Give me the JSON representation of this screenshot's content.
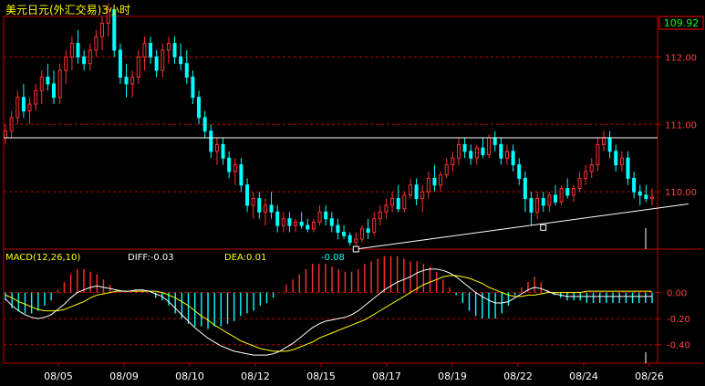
{
  "chart_data": [
    {
      "type": "candlestick",
      "title": "美元日元(外汇交易)3小时",
      "ylim": [
        109.15,
        112.6
      ],
      "y_ticks": [
        "112.00",
        "111.00",
        "110.00"
      ],
      "last_price": "109.92",
      "grid": "dashed horizontal",
      "x_ticks": [
        "08/05",
        "08/09",
        "08/10",
        "08/12",
        "08/15",
        "08/17",
        "08/19",
        "08/22",
        "08/24",
        "08/26"
      ],
      "candles": [
        [
          110.8,
          111.0,
          110.7,
          110.9
        ],
        [
          110.9,
          111.2,
          110.8,
          111.1
        ],
        [
          111.1,
          111.5,
          111.0,
          111.4
        ],
        [
          111.4,
          111.6,
          111.1,
          111.2
        ],
        [
          111.2,
          111.4,
          111.0,
          111.3
        ],
        [
          111.3,
          111.6,
          111.2,
          111.5
        ],
        [
          111.5,
          111.8,
          111.3,
          111.7
        ],
        [
          111.7,
          111.9,
          111.5,
          111.6
        ],
        [
          111.6,
          111.8,
          111.3,
          111.4
        ],
        [
          111.4,
          111.9,
          111.3,
          111.8
        ],
        [
          111.8,
          112.1,
          111.6,
          112.0
        ],
        [
          112.0,
          112.3,
          111.8,
          112.2
        ],
        [
          112.2,
          112.4,
          111.9,
          112.0
        ],
        [
          112.0,
          112.1,
          111.8,
          111.9
        ],
        [
          111.9,
          112.2,
          111.8,
          112.1
        ],
        [
          112.1,
          112.4,
          112.0,
          112.3
        ],
        [
          112.3,
          112.6,
          112.1,
          112.5
        ],
        [
          112.5,
          112.8,
          112.3,
          112.7
        ],
        [
          112.7,
          112.7,
          112.0,
          112.1
        ],
        [
          112.1,
          112.2,
          111.6,
          111.7
        ],
        [
          111.7,
          111.9,
          111.4,
          111.6
        ],
        [
          111.6,
          111.8,
          111.4,
          111.7
        ],
        [
          111.7,
          112.1,
          111.6,
          112.0
        ],
        [
          112.0,
          112.3,
          111.8,
          112.2
        ],
        [
          112.2,
          112.3,
          111.9,
          112.0
        ],
        [
          112.0,
          112.1,
          111.7,
          111.8
        ],
        [
          111.8,
          112.2,
          111.7,
          112.1
        ],
        [
          112.1,
          112.3,
          111.9,
          112.2
        ],
        [
          112.2,
          112.3,
          111.9,
          112.0
        ],
        [
          112.0,
          112.2,
          111.8,
          111.9
        ],
        [
          111.9,
          112.1,
          111.6,
          111.7
        ],
        [
          111.7,
          111.8,
          111.3,
          111.4
        ],
        [
          111.4,
          111.5,
          111.0,
          111.1
        ],
        [
          111.1,
          111.2,
          110.8,
          110.9
        ],
        [
          110.9,
          111.0,
          110.5,
          110.6
        ],
        [
          110.6,
          110.8,
          110.4,
          110.7
        ],
        [
          110.7,
          110.8,
          110.4,
          110.5
        ],
        [
          110.5,
          110.6,
          110.2,
          110.3
        ],
        [
          110.3,
          110.5,
          110.1,
          110.4
        ],
        [
          110.4,
          110.5,
          110.0,
          110.1
        ],
        [
          110.1,
          110.2,
          109.7,
          109.8
        ],
        [
          109.8,
          110.0,
          109.6,
          109.9
        ],
        [
          109.9,
          110.0,
          109.6,
          109.7
        ],
        [
          109.7,
          109.9,
          109.5,
          109.8
        ],
        [
          109.8,
          110.0,
          109.6,
          109.7
        ],
        [
          109.7,
          109.8,
          109.4,
          109.5
        ],
        [
          109.5,
          109.7,
          109.4,
          109.6
        ],
        [
          109.6,
          109.7,
          109.4,
          109.5
        ],
        [
          109.5,
          109.6,
          109.4,
          109.55
        ],
        [
          109.55,
          109.7,
          109.45,
          109.5
        ],
        [
          109.5,
          109.6,
          109.4,
          109.45
        ],
        [
          109.45,
          109.6,
          109.4,
          109.55
        ],
        [
          109.55,
          109.8,
          109.5,
          109.7
        ],
        [
          109.7,
          109.8,
          109.5,
          109.6
        ],
        [
          109.6,
          109.7,
          109.4,
          109.5
        ],
        [
          109.5,
          109.6,
          109.3,
          109.4
        ],
        [
          109.4,
          109.5,
          109.3,
          109.35
        ],
        [
          109.35,
          109.4,
          109.2,
          109.25
        ],
        [
          109.25,
          109.4,
          109.15,
          109.3
        ],
        [
          109.3,
          109.5,
          109.25,
          109.45
        ],
        [
          109.45,
          109.6,
          109.3,
          109.4
        ],
        [
          109.4,
          109.7,
          109.35,
          109.6
        ],
        [
          109.6,
          109.8,
          109.5,
          109.7
        ],
        [
          109.7,
          109.9,
          109.6,
          109.8
        ],
        [
          109.8,
          110.0,
          109.7,
          109.9
        ],
        [
          109.9,
          110.1,
          109.7,
          109.75
        ],
        [
          109.75,
          110.0,
          109.7,
          109.95
        ],
        [
          109.95,
          110.2,
          109.9,
          110.1
        ],
        [
          110.1,
          110.2,
          109.8,
          109.9
        ],
        [
          109.9,
          110.1,
          109.7,
          110.0
        ],
        [
          110.0,
          110.3,
          109.9,
          110.2
        ],
        [
          110.2,
          110.4,
          110.0,
          110.1
        ],
        [
          110.1,
          110.3,
          110.0,
          110.25
        ],
        [
          110.25,
          110.5,
          110.2,
          110.4
        ],
        [
          110.4,
          110.6,
          110.3,
          110.5
        ],
        [
          110.5,
          110.8,
          110.4,
          110.7
        ],
        [
          110.7,
          110.8,
          110.5,
          110.6
        ],
        [
          110.6,
          110.7,
          110.4,
          110.5
        ],
        [
          110.5,
          110.7,
          110.4,
          110.65
        ],
        [
          110.65,
          110.8,
          110.5,
          110.55
        ],
        [
          110.55,
          110.85,
          110.5,
          110.8
        ],
        [
          110.8,
          110.9,
          110.6,
          110.7
        ],
        [
          110.7,
          110.8,
          110.4,
          110.5
        ],
        [
          110.5,
          110.7,
          110.4,
          110.6
        ],
        [
          110.6,
          110.7,
          110.3,
          110.4
        ],
        [
          110.4,
          110.5,
          110.1,
          110.2
        ],
        [
          110.2,
          110.3,
          109.7,
          109.9
        ],
        [
          109.9,
          110.0,
          109.5,
          109.7
        ],
        [
          109.7,
          110.0,
          109.6,
          109.9
        ],
        [
          109.9,
          110.0,
          109.7,
          109.8
        ],
        [
          109.8,
          110.0,
          109.7,
          109.95
        ],
        [
          109.95,
          110.1,
          109.8,
          109.85
        ],
        [
          109.85,
          110.1,
          109.8,
          110.05
        ],
        [
          110.05,
          110.2,
          109.9,
          109.95
        ],
        [
          109.95,
          110.1,
          109.85,
          110.05
        ],
        [
          110.05,
          110.3,
          110.0,
          110.2
        ],
        [
          110.2,
          110.4,
          110.1,
          110.3
        ],
        [
          110.3,
          110.5,
          110.2,
          110.4
        ],
        [
          110.4,
          110.8,
          110.3,
          110.7
        ],
        [
          110.7,
          110.9,
          110.6,
          110.8
        ],
        [
          110.8,
          110.9,
          110.5,
          110.6
        ],
        [
          110.6,
          110.7,
          110.3,
          110.4
        ],
        [
          110.4,
          110.6,
          110.3,
          110.5
        ],
        [
          110.5,
          110.6,
          110.1,
          110.2
        ],
        [
          110.2,
          110.3,
          109.9,
          110.0
        ],
        [
          110.0,
          110.1,
          109.8,
          109.95
        ],
        [
          109.95,
          110.1,
          109.85,
          109.9
        ],
        [
          109.9,
          110.05,
          109.8,
          109.92
        ]
      ],
      "horizontal_line": 110.8,
      "trend_line": [
        [
          58,
          109.15
        ],
        [
          113,
          109.82
        ]
      ],
      "markers": [
        {
          "index": 58,
          "price": 109.15
        },
        {
          "index": 89,
          "price": 109.47
        }
      ]
    },
    {
      "type": "macd",
      "legend": "MACD(12,26,10)",
      "diff_text": "DIFF:-0.03",
      "dea_text": "DEA:0.01",
      "macd_text": "-0.08",
      "ylim": [
        -0.5,
        0.2
      ],
      "y_ticks": [
        "0.00",
        "-0.20",
        "-0.40"
      ],
      "diff": [
        -0.05,
        -0.1,
        -0.14,
        -0.17,
        -0.19,
        -0.2,
        -0.19,
        -0.17,
        -0.13,
        -0.09,
        -0.04,
        0.0,
        0.02,
        0.04,
        0.05,
        0.04,
        0.03,
        0.02,
        0.01,
        0.01,
        0.02,
        0.02,
        0.01,
        -0.01,
        -0.03,
        -0.07,
        -0.12,
        -0.17,
        -0.22,
        -0.27,
        -0.31,
        -0.35,
        -0.38,
        -0.41,
        -0.43,
        -0.45,
        -0.46,
        -0.47,
        -0.48,
        -0.48,
        -0.48,
        -0.47,
        -0.45,
        -0.42,
        -0.39,
        -0.35,
        -0.31,
        -0.27,
        -0.24,
        -0.22,
        -0.21,
        -0.2,
        -0.19,
        -0.17,
        -0.14,
        -0.1,
        -0.06,
        -0.02,
        0.02,
        0.05,
        0.08,
        0.1,
        0.12,
        0.15,
        0.17,
        0.18,
        0.18,
        0.17,
        0.15,
        0.12,
        0.08,
        0.04,
        0.0,
        -0.03,
        -0.06,
        -0.08,
        -0.08,
        -0.07,
        -0.04,
        -0.01,
        0.02,
        0.04,
        0.03,
        0.01,
        -0.01,
        -0.02,
        -0.03,
        -0.03,
        -0.03,
        -0.03,
        -0.03,
        -0.03,
        -0.03,
        -0.03,
        -0.03,
        -0.03,
        -0.03,
        -0.03,
        -0.03,
        -0.03
      ],
      "dea": [
        -0.02,
        -0.04,
        -0.07,
        -0.09,
        -0.11,
        -0.13,
        -0.14,
        -0.14,
        -0.14,
        -0.13,
        -0.11,
        -0.09,
        -0.07,
        -0.04,
        -0.02,
        -0.01,
        0.0,
        0.01,
        0.01,
        0.01,
        0.01,
        0.01,
        0.01,
        0.01,
        0.0,
        -0.02,
        -0.04,
        -0.07,
        -0.1,
        -0.14,
        -0.18,
        -0.21,
        -0.25,
        -0.28,
        -0.31,
        -0.34,
        -0.37,
        -0.39,
        -0.41,
        -0.43,
        -0.44,
        -0.45,
        -0.45,
        -0.45,
        -0.44,
        -0.42,
        -0.4,
        -0.38,
        -0.35,
        -0.33,
        -0.31,
        -0.29,
        -0.27,
        -0.25,
        -0.23,
        -0.21,
        -0.18,
        -0.15,
        -0.12,
        -0.09,
        -0.06,
        -0.03,
        0.0,
        0.03,
        0.06,
        0.08,
        0.1,
        0.12,
        0.13,
        0.13,
        0.12,
        0.11,
        0.09,
        0.07,
        0.04,
        0.02,
        0.0,
        -0.02,
        -0.03,
        -0.03,
        -0.02,
        -0.02,
        -0.01,
        0.0,
        0.0,
        0.0,
        0.0,
        0.0,
        0.0,
        0.01,
        0.01,
        0.01,
        0.01,
        0.01,
        0.01,
        0.01,
        0.01,
        0.01,
        0.01,
        0.01
      ]
    }
  ],
  "colors": {
    "up": "#ff3030",
    "down": "#00ffff",
    "diff_line": "#ffffff",
    "dea_line": "#ffff00",
    "grid": "#c00000",
    "axis_text": "#ff4040",
    "last_price_text": "#00ff00",
    "hline": "#ffffff"
  }
}
